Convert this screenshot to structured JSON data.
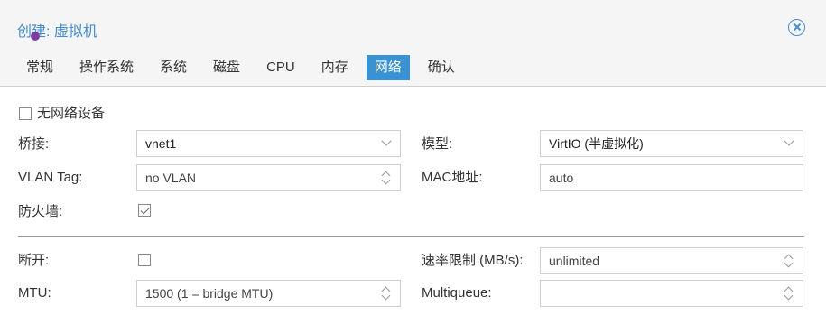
{
  "dialog": {
    "title": "创建: 虚拟机"
  },
  "tabs": [
    {
      "label": "常规"
    },
    {
      "label": "操作系统"
    },
    {
      "label": "系统"
    },
    {
      "label": "磁盘"
    },
    {
      "label": "CPU"
    },
    {
      "label": "内存"
    },
    {
      "label": "网络",
      "active": true
    },
    {
      "label": "确认"
    }
  ],
  "form": {
    "no_network": {
      "label": "无网络设备",
      "checked": false
    },
    "bridge": {
      "label": "桥接:",
      "value": "vnet1"
    },
    "model": {
      "label": "模型:",
      "value": "VirtIO (半虚拟化)"
    },
    "vlan_tag": {
      "label": "VLAN Tag:",
      "placeholder": "no VLAN"
    },
    "mac": {
      "label": "MAC地址:",
      "placeholder": "auto"
    },
    "firewall": {
      "label": "防火墙:",
      "checked": true
    },
    "disconnect": {
      "label": "断开:",
      "checked": false
    },
    "rate_limit": {
      "label": "速率限制 (MB/s):",
      "placeholder": "unlimited"
    },
    "mtu": {
      "label": "MTU:",
      "placeholder": "1500 (1 = bridge MTU)"
    },
    "multiqueue": {
      "label": "Multiqueue:",
      "value": ""
    }
  },
  "colors": {
    "accent": "#3892d3",
    "title": "#3d8dd8"
  }
}
